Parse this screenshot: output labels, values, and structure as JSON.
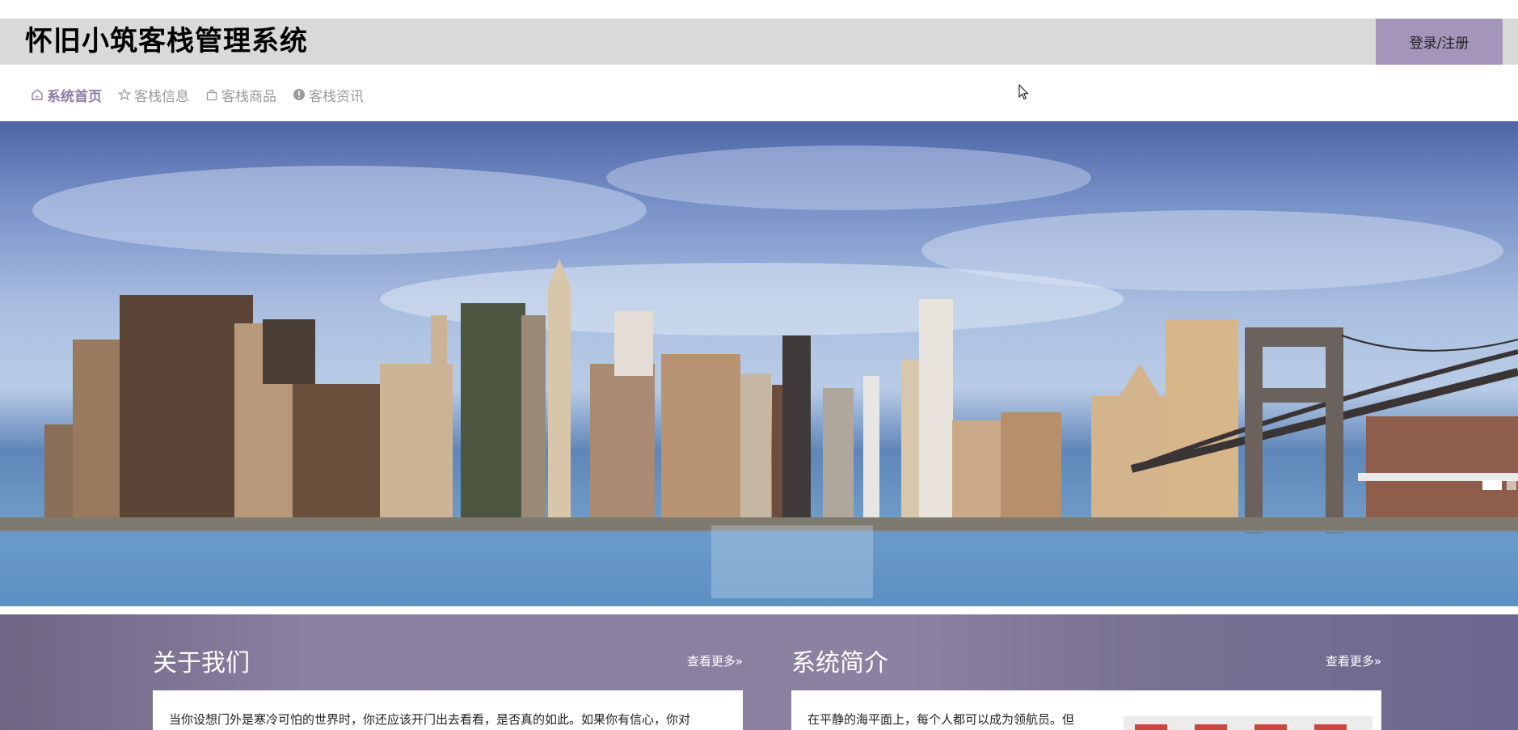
{
  "header": {
    "title": "怀旧小筑客栈管理系统",
    "login_label": "登录/注册"
  },
  "nav": {
    "items": [
      {
        "label": "系统首页",
        "icon": "home-icon",
        "active": true
      },
      {
        "label": "客栈信息",
        "icon": "star-icon",
        "active": false
      },
      {
        "label": "客栈商品",
        "icon": "bag-icon",
        "active": false
      },
      {
        "label": "客栈资讯",
        "icon": "info-icon",
        "active": false
      }
    ]
  },
  "hero": {
    "image": "city-skyline-bridge",
    "slides": 2,
    "active_slide": 1
  },
  "about": {
    "title": "关于我们",
    "more_label": "查看更多»",
    "text": "当你设想门外是寒冷可怕的世界时，你还应该开门出去看看，是否真的如此。如果你有信心，你对"
  },
  "intro": {
    "title": "系统简介",
    "more_label": "查看更多»",
    "text": "在平静的海平面上，每个人都可以成为领航员。但"
  },
  "colors": {
    "accent": "#8c7da8",
    "login_bg": "#a496bb",
    "header_bg": "#d9d9d9",
    "section_bg": "#8a7fa0"
  }
}
